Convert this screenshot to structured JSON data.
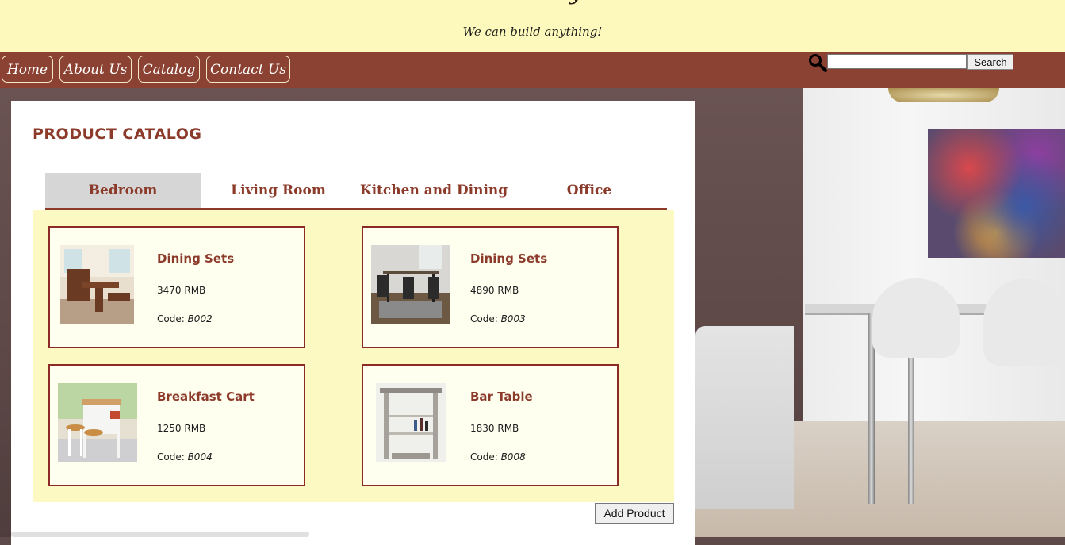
{
  "header": {
    "tagline": "We can build anything!"
  },
  "nav": {
    "items": [
      {
        "label": "Home"
      },
      {
        "label": "About Us"
      },
      {
        "label": "Catalog"
      },
      {
        "label": "Contact Us"
      }
    ]
  },
  "search": {
    "value": "",
    "placeholder": "",
    "button_label": "Search",
    "icon": "search-icon"
  },
  "catalog": {
    "title": "PRODUCT CATALOG",
    "tabs": [
      {
        "label": "Bedroom",
        "active": true
      },
      {
        "label": "Living Room",
        "active": false
      },
      {
        "label": "Kitchen and Dining",
        "active": false
      },
      {
        "label": "Office",
        "active": false
      }
    ],
    "products": [
      {
        "name": "Dining Sets",
        "price": "3470 RMB",
        "code_label": "Code: ",
        "code": "B002"
      },
      {
        "name": "Dining Sets",
        "price": "4890 RMB",
        "code_label": "Code: ",
        "code": "B003"
      },
      {
        "name": "Breakfast Cart",
        "price": "1250 RMB",
        "code_label": "Code: ",
        "code": "B004"
      },
      {
        "name": "Bar Table",
        "price": "1830 RMB",
        "code_label": "Code: ",
        "code": "B008"
      }
    ],
    "add_button_label": "Add Product"
  },
  "colors": {
    "header_bg": "#fdf8bc",
    "nav_bg": "#8c4232",
    "accent": "#8c3b2b",
    "products_bg": "#fdf9c2",
    "card_border": "#8c2a25"
  }
}
